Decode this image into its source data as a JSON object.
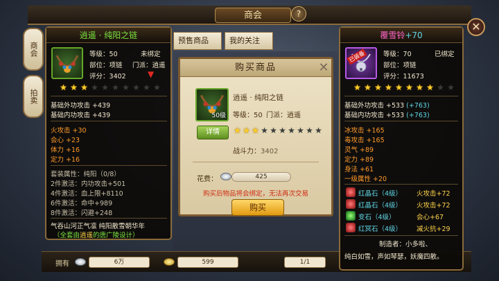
{
  "window": {
    "title": "商会",
    "help": "?",
    "close": "✕"
  },
  "side_tabs": [
    "商会",
    "拍卖"
  ],
  "bg_tabs": [
    "预售商品",
    "我的关注"
  ],
  "bottom_bar": {
    "label": "拥有",
    "silver": "6万",
    "gold": "599",
    "page": "1/1"
  },
  "left_item": {
    "title": "逍遥 · 纯阳之链",
    "level_label": "等级",
    "level": "50",
    "bind_status": "未绑定",
    "slot_label": "部位",
    "slot": "项链",
    "school_label": "门派",
    "school": "逍遥",
    "score_label": "评分",
    "score": "3402",
    "stars_on": 3,
    "stars_total": 10,
    "base_stats": [
      {
        "name": "基础外功攻击",
        "value": "+439"
      },
      {
        "name": "基础内功攻击",
        "value": "+439"
      }
    ],
    "extra_stats": [
      {
        "name": "火攻击",
        "value": "+30"
      },
      {
        "name": "会心",
        "value": "+23"
      },
      {
        "name": "体力",
        "value": "+16"
      },
      {
        "name": "定力",
        "value": "+16"
      }
    ],
    "set_header": "套装属性：纯阳（0/8）",
    "set_bonuses": [
      {
        "req": "2件激活：",
        "effect": "内功攻击+501"
      },
      {
        "req": "4件激活：",
        "effect": "血上限+8110"
      },
      {
        "req": "6件激活：",
        "effect": "命中+989"
      },
      {
        "req": "8件激活：",
        "effect": "闪避+248"
      }
    ],
    "set_name": "气吞山河正气凛 纯阳散雪朝华年",
    "set_note_prefix": "（全套由",
    "set_note_school": "逍遥",
    "set_note_suffix": "的唐广陵设计）",
    "colors": {
      "title": "#7be23f",
      "stars": "#ffd02a"
    }
  },
  "purchase_modal": {
    "title": "购买商品",
    "item_name": "逍遥 · 纯阳之链",
    "level_label": "等级：",
    "level": "50",
    "school_label": "门派：",
    "school": "逍遥",
    "item_level_badge": "50级",
    "detail_button": "详情",
    "stars_on": 3,
    "stars_total": 10,
    "power_label": "战斗力：",
    "power": "3402",
    "cost_label": "花费：",
    "cost": "425",
    "warning": "购买后物品将会绑定，无法再次交易",
    "buy_button": "购买"
  },
  "right_item": {
    "title_name": "覆雪铃",
    "title_plus": "+70",
    "badge": "已装备",
    "level_label": "等级",
    "level": "70",
    "bind_status": "已绑定",
    "slot_label": "部位",
    "slot": "项链",
    "score_label": "评分",
    "score": "11673",
    "stars_on": 8,
    "stars_total": 10,
    "base_stats": [
      {
        "name": "基础外功攻击",
        "value": "+533",
        "bonus": "(+763)"
      },
      {
        "name": "基础内功攻击",
        "value": "+533",
        "bonus": "(+763)"
      }
    ],
    "extra_stats": [
      {
        "name": "冰攻击",
        "value": "+165"
      },
      {
        "name": "毒攻击",
        "value": "+165"
      },
      {
        "name": "灵气",
        "value": "+89"
      },
      {
        "name": "定力",
        "value": "+89"
      },
      {
        "name": "身法",
        "value": "+61"
      },
      {
        "name": "一级属性",
        "value": "+20"
      }
    ],
    "gems": [
      {
        "name": "红晶石",
        "level": "（4级）",
        "effect": "火攻击+72",
        "color": "red"
      },
      {
        "name": "红晶石",
        "level": "（4级）",
        "effect": "火攻击+72",
        "color": "red"
      },
      {
        "name": "变石",
        "level": "（4级）",
        "effect": "会心+67",
        "color": "green"
      },
      {
        "name": "红冥石",
        "level": "（4级）",
        "effect": "减火抗+29",
        "color": "red"
      }
    ],
    "maker": "制造者：小多啦、",
    "flavor": "纯白如雪，声如琴瑟，妖魔四散。",
    "colors": {
      "title": "#ff66c8",
      "bonus": "#5fd6e6"
    }
  }
}
